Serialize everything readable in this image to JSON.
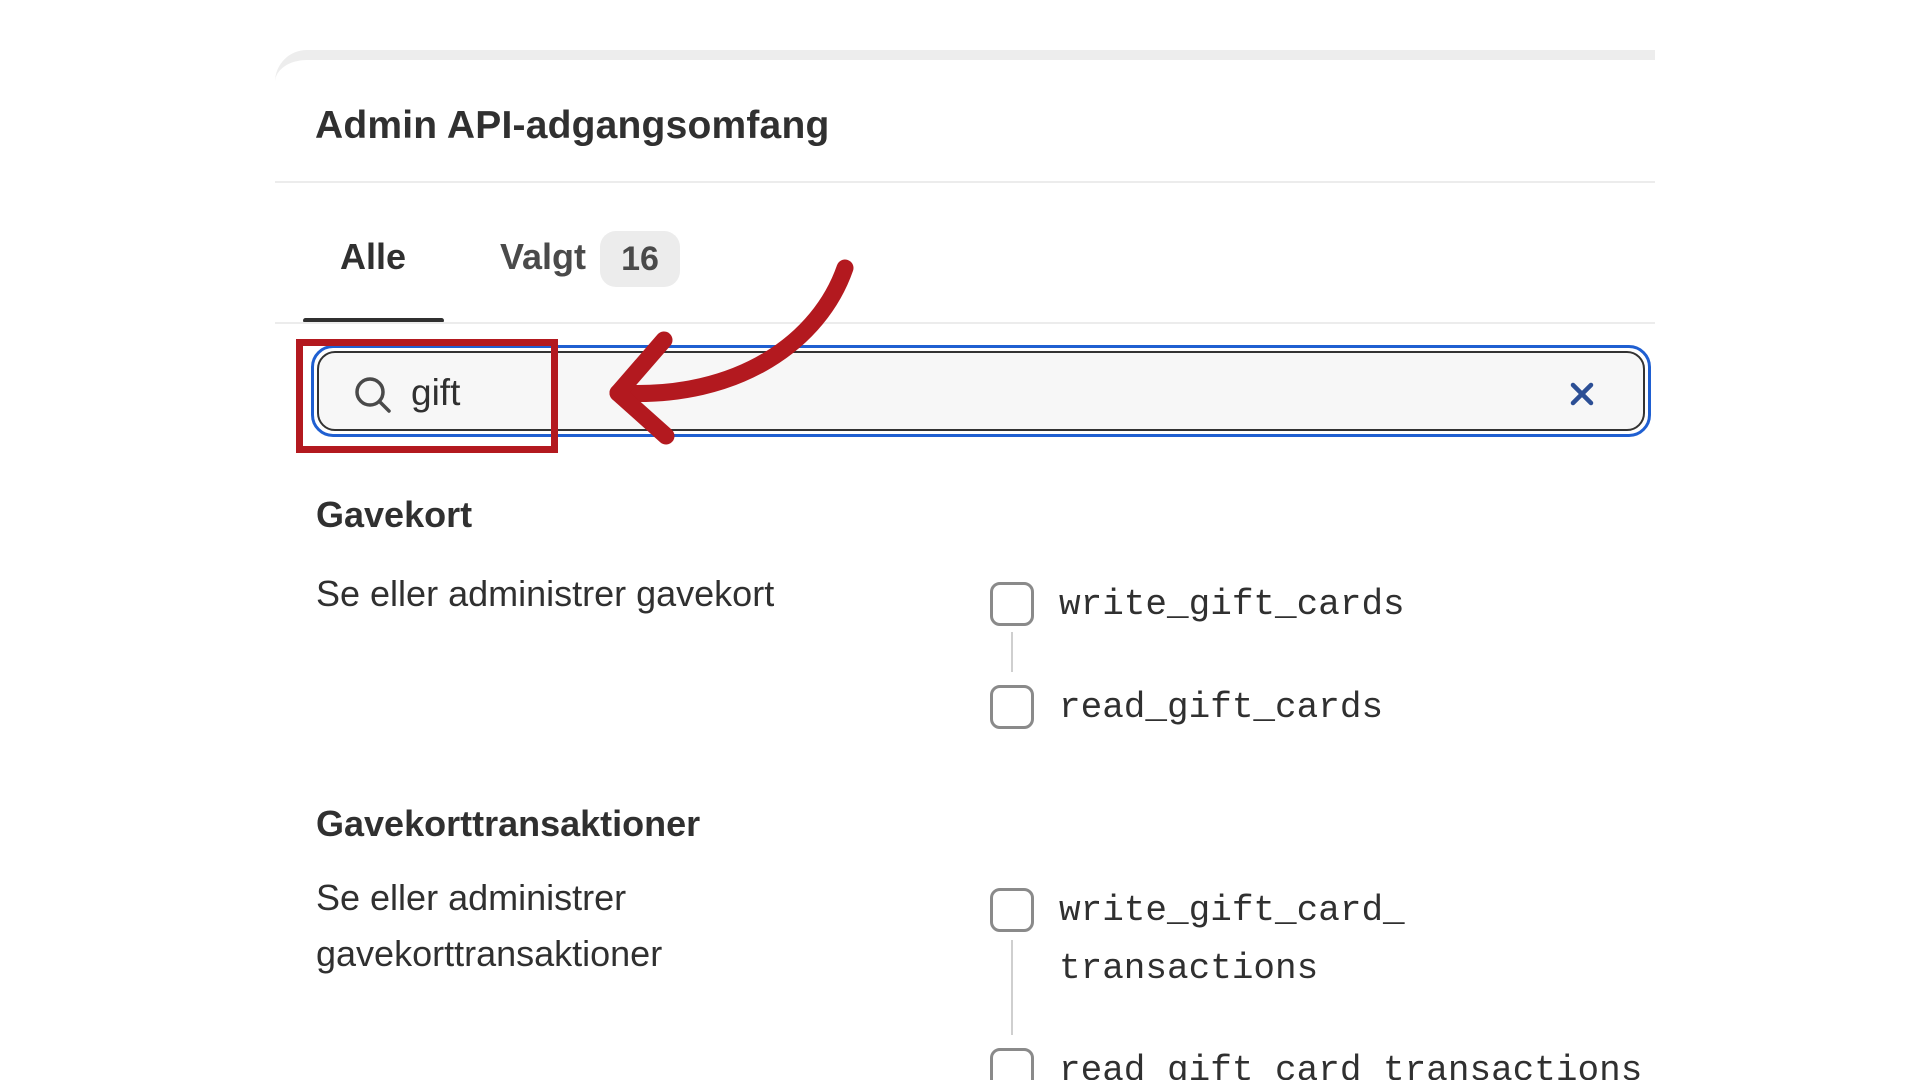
{
  "panel": {
    "title": "Admin API-adgangsomfang"
  },
  "tabs": [
    {
      "label": "Alle",
      "active": true
    },
    {
      "label": "Valgt",
      "badge": "16",
      "active": false
    }
  ],
  "search": {
    "value": "gift",
    "placeholder": ""
  },
  "sections": [
    {
      "title": "Gavekort",
      "description": "Se eller administrer gavekort",
      "scopes": [
        "write_gift_cards",
        "read_gift_cards"
      ]
    },
    {
      "title": "Gavekorttransaktioner",
      "description_lines": [
        "Se eller administrer",
        "gavekorttransaktioner"
      ],
      "scopes": [
        {
          "lines": [
            "write_gift_card_",
            "transactions"
          ]
        },
        {
          "lines": [
            "read_gift_card_transactions"
          ]
        }
      ]
    }
  ],
  "colors": {
    "accent_focus": "#1f5fd1",
    "annotation_red": "#b3191f",
    "text": "#303030"
  },
  "icons": {
    "search": "search-icon",
    "clear": "close-icon"
  }
}
